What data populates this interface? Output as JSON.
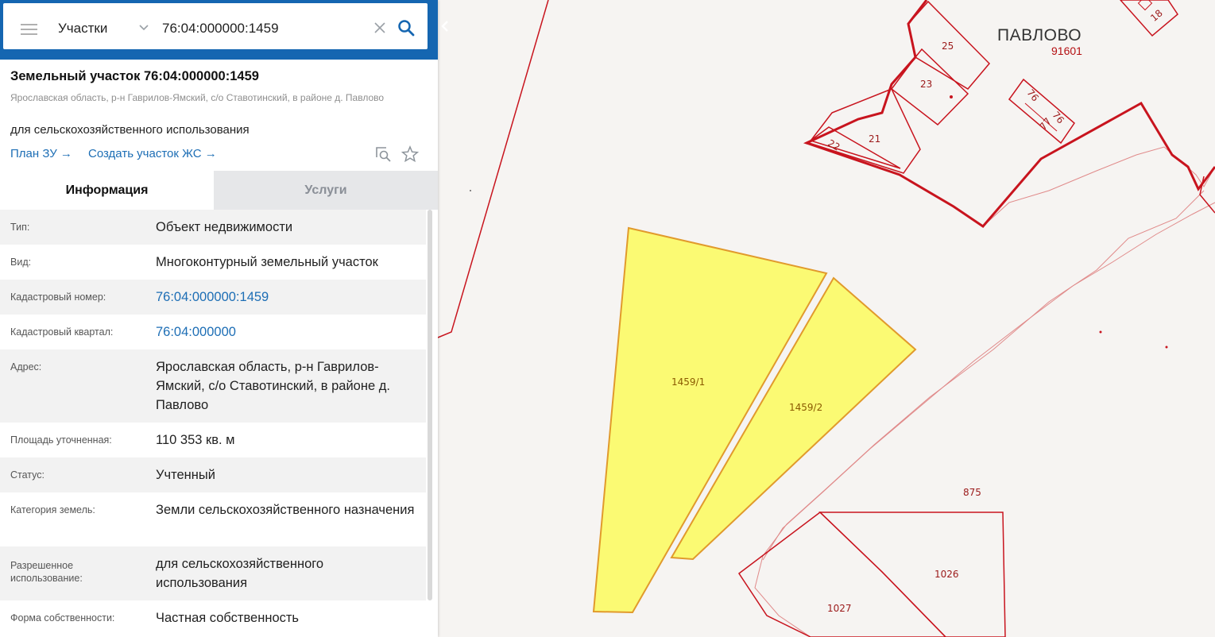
{
  "search": {
    "layer": "Участки",
    "query": "76:04:000000:1459"
  },
  "object": {
    "title": "Земельный участок 76:04:000000:1459",
    "address": "Ярославская область, р-н Гаврилов-Ямский, с/о Ставотинский, в районе д. Павлово",
    "use": "для сельскохозяйственного использования",
    "links": {
      "plan": "План ЗУ",
      "create": "Создать участок ЖС"
    }
  },
  "tabs": {
    "info": "Информация",
    "services": "Услуги"
  },
  "info": {
    "type": {
      "label": "Тип:",
      "value": "Объект недвижимости"
    },
    "kind": {
      "label": "Вид:",
      "value": "Многоконтурный земельный участок"
    },
    "cad_number": {
      "label": "Кадастровый номер:",
      "value": "76:04:000000:1459"
    },
    "cad_quarter": {
      "label": "Кадастровый квартал:",
      "value": "76:04:000000"
    },
    "address": {
      "label": "Адрес:",
      "value": "Ярославская область, р-н Гаврилов-Ямский, с/о Ставотинский, в районе д. Павлово"
    },
    "area": {
      "label": "Площадь уточненная:",
      "value": "110 353 кв. м"
    },
    "status": {
      "label": "Статус:",
      "value": "Учтенный"
    },
    "category": {
      "label": "Категория земель:",
      "value": "Земли сельскохозяйственного назначения"
    },
    "permitted_use": {
      "label": "Разрешенное использование:",
      "value": "для сельскохозяйственного использования"
    },
    "ownership": {
      "label": "Форма собственности:",
      "value": "Частная собственность"
    }
  },
  "map": {
    "place": "ПАВЛОВО",
    "place_code": "91601",
    "parcels": [
      "18",
      "25",
      "23",
      "21",
      "22",
      "76",
      "76",
      "77",
      "875",
      "1026",
      "1027"
    ],
    "highlighted": [
      "1459/1",
      "1459/2"
    ]
  },
  "colors": {
    "header": "#1566b1",
    "boundary": "#c8141e",
    "highlight_fill": "#fbfa73",
    "link": "#1d6eb5"
  }
}
